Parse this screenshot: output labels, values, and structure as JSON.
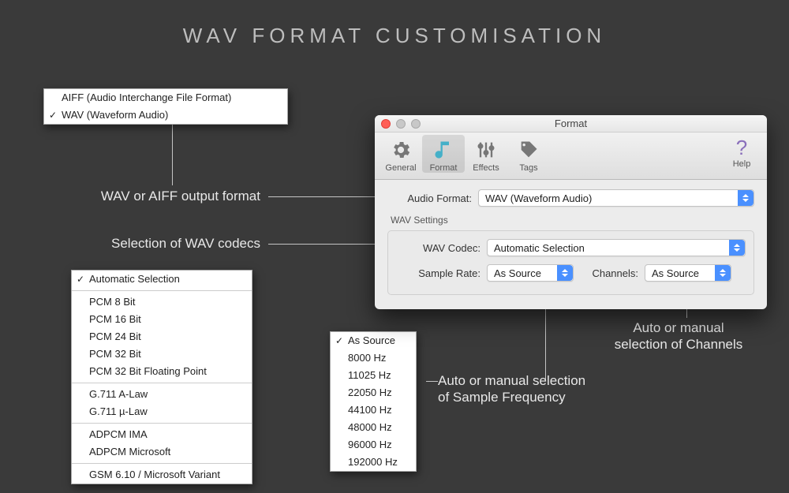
{
  "page_title": "WAV  FORMAT  CUSTOMISATION",
  "annotations": {
    "format": "WAV or AIFF output format",
    "codec": "Selection of WAV codecs",
    "rate": "Auto or manual selection\nof Sample Frequency",
    "channels": "Auto or manual\nselection of Channels"
  },
  "format_menu": {
    "items": [
      {
        "label": "AIFF (Audio Interchange File Format)",
        "checked": false
      },
      {
        "label": "WAV (Waveform Audio)",
        "checked": true
      }
    ]
  },
  "codec_menu": {
    "groups": [
      [
        {
          "label": "Automatic Selection",
          "checked": true
        }
      ],
      [
        {
          "label": "PCM 8 Bit"
        },
        {
          "label": "PCM 16 Bit"
        },
        {
          "label": "PCM 24 Bit"
        },
        {
          "label": "PCM 32 Bit"
        },
        {
          "label": "PCM 32 Bit Floating Point"
        }
      ],
      [
        {
          "label": "G.711 A-Law"
        },
        {
          "label": "G.711 µ-Law"
        }
      ],
      [
        {
          "label": "ADPCM IMA"
        },
        {
          "label": "ADPCM Microsoft"
        }
      ],
      [
        {
          "label": "GSM 6.10 / Microsoft Variant"
        }
      ]
    ]
  },
  "rate_menu": {
    "items": [
      {
        "label": "As Source",
        "checked": true
      },
      {
        "label": "8000 Hz"
      },
      {
        "label": "11025 Hz"
      },
      {
        "label": "22050 Hz"
      },
      {
        "label": "44100 Hz"
      },
      {
        "label": "48000 Hz"
      },
      {
        "label": "96000 Hz"
      },
      {
        "label": "192000 Hz"
      }
    ]
  },
  "window": {
    "title": "Format",
    "toolbar": {
      "general": "General",
      "format": "Format",
      "effects": "Effects",
      "tags": "Tags",
      "help": "Help"
    },
    "labels": {
      "audio_format": "Audio Format:",
      "wav_settings": "WAV Settings",
      "wav_codec": "WAV Codec:",
      "sample_rate": "Sample Rate:",
      "channels": "Channels:"
    },
    "values": {
      "audio_format": "WAV (Waveform Audio)",
      "wav_codec": "Automatic Selection",
      "sample_rate": "As Source",
      "channels": "As Source"
    }
  }
}
